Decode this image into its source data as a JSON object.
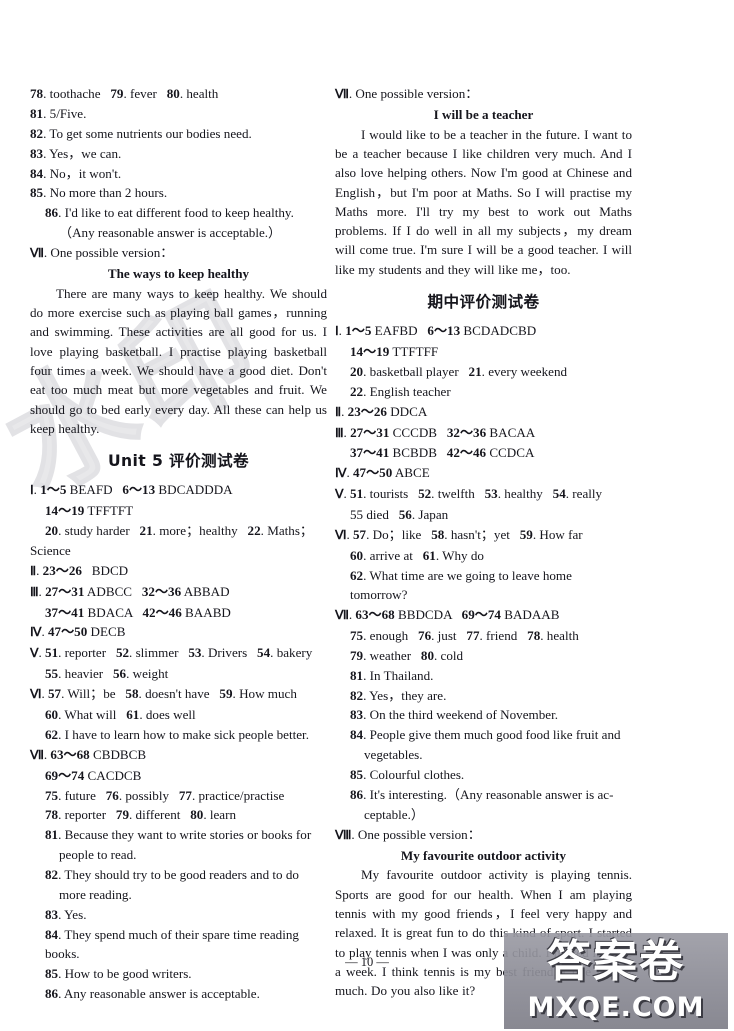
{
  "page": {
    "page_number": "— 10 —",
    "background_watermark": "水印"
  },
  "watermark_stamp": {
    "chinese": "答案卷",
    "url": "MXQE.COM"
  },
  "left_column": {
    "blocks": [
      {
        "id": "l1",
        "type": "line",
        "text": "78. toothache   79. fever   80. health"
      },
      {
        "id": "l2",
        "type": "line",
        "text": "81. 5/Five."
      },
      {
        "id": "l3",
        "type": "line",
        "text": "82. To get some nutrients our bodies need."
      },
      {
        "id": "l4",
        "type": "line",
        "text": "83. Yes，we can."
      },
      {
        "id": "l5",
        "type": "line",
        "text": "84. No，it won't."
      },
      {
        "id": "l6",
        "type": "line",
        "text": "85. No more than 2 hours."
      },
      {
        "id": "l7",
        "type": "hang",
        "text": "86. I'd like to eat different food to keep healthy."
      },
      {
        "id": "l8",
        "type": "indent2",
        "text": "（Any reasonable answer is acceptable.）"
      },
      {
        "id": "l9",
        "type": "line",
        "text": "Ⅶ. One possible version："
      },
      {
        "id": "l10",
        "type": "comp-title",
        "text": "The ways to keep healthy"
      },
      {
        "id": "l11",
        "type": "para",
        "text": "There are many ways to keep healthy. We should do more exercise such as playing ball games，running and swimming. These activities are all good for us. I love playing basketball. I practise playing basketball four times a week. We should have a good diet. Don't eat too much meat but more vegetables and fruit. We should go to bed early every day. All these can help us keep healthy."
      },
      {
        "id": "l12",
        "type": "sec-head",
        "text": "Unit 5 评价测试卷"
      },
      {
        "id": "l13",
        "type": "line",
        "text": "Ⅰ. 1～5 BEAFD   6～13 BDCADDDA"
      },
      {
        "id": "l14",
        "type": "indent",
        "text": "14～19 TFFTFT"
      },
      {
        "id": "l15",
        "type": "indent",
        "text": "20. study harder   21. more；healthy   22. Maths；"
      },
      {
        "id": "l16",
        "type": "line",
        "text": "Science"
      },
      {
        "id": "l17",
        "type": "line",
        "text": "Ⅱ. 23～26   BDCD"
      },
      {
        "id": "l18",
        "type": "line",
        "text": "Ⅲ. 27～31 ADBCC   32～36 ABBAD"
      },
      {
        "id": "l19",
        "type": "indent",
        "text": "37～41 BDACA   42～46 BAABD"
      },
      {
        "id": "l20",
        "type": "line",
        "text": "Ⅳ. 47～50 DECB"
      },
      {
        "id": "l21",
        "type": "line",
        "text": "Ⅴ. 51. reporter   52. slimmer   53. Drivers   54. bakery"
      },
      {
        "id": "l22",
        "type": "indent",
        "text": "55. heavier   56. weight"
      },
      {
        "id": "l23",
        "type": "line",
        "text": "Ⅵ. 57. Will；be   58. doesn't have   59. How much"
      },
      {
        "id": "l24",
        "type": "indent",
        "text": "60. What will   61. does well"
      },
      {
        "id": "l25",
        "type": "indent",
        "text": "62. I have to learn how to make sick people better."
      },
      {
        "id": "l26",
        "type": "line",
        "text": "Ⅶ. 63～68 CBDBCB"
      },
      {
        "id": "l27",
        "type": "indent",
        "text": "69～74 CACDCB"
      },
      {
        "id": "l28",
        "type": "indent",
        "text": "75. future   76. possibly   77. practice/practise"
      },
      {
        "id": "l29",
        "type": "indent",
        "text": "78. reporter   79. different   80. learn"
      },
      {
        "id": "l30",
        "type": "hang",
        "text": "81. Because they want to write stories or books for"
      },
      {
        "id": "l31",
        "type": "indent2",
        "text": "people to read."
      },
      {
        "id": "l32",
        "type": "hang-j",
        "text": "82. They should try to be good readers and to do"
      },
      {
        "id": "l33",
        "type": "indent2",
        "text": "more reading."
      },
      {
        "id": "l34",
        "type": "indent",
        "text": "83. Yes."
      },
      {
        "id": "l35",
        "type": "indent",
        "text": "84. They spend much of their spare time reading books."
      },
      {
        "id": "l36",
        "type": "indent",
        "text": "85. How to be good writers."
      },
      {
        "id": "l37",
        "type": "indent",
        "text": "86. Any reasonable answer is acceptable."
      }
    ]
  },
  "right_column": {
    "blocks": [
      {
        "id": "r1",
        "type": "line",
        "text": "Ⅶ. One possible version："
      },
      {
        "id": "r2",
        "type": "comp-title",
        "text": "I will be a teacher"
      },
      {
        "id": "r3",
        "type": "para",
        "text": "I would like to be a teacher in the future. I want to be a teacher because I like children very much. And I also love helping others. Now I'm good at Chinese and English，but I'm poor at Maths. So I will practise my Maths more. I'll try my best to work out Maths problems. If I do well in all my subjects，my dream will come true. I'm sure I will be a good teacher. I will like my students and they will like me，too."
      },
      {
        "id": "r4",
        "type": "sec-head",
        "text": "期中评价测试卷"
      },
      {
        "id": "r5",
        "type": "line",
        "text": "Ⅰ. 1～5 EAFBD   6～13 BCDADCBD"
      },
      {
        "id": "r6",
        "type": "indent",
        "text": "14～19 TTFTFF"
      },
      {
        "id": "r7",
        "type": "indent",
        "text": "20. basketball player   21. every weekend"
      },
      {
        "id": "r8",
        "type": "indent",
        "text": "22. English teacher"
      },
      {
        "id": "r9",
        "type": "line",
        "text": "Ⅱ. 23～26 DDCA"
      },
      {
        "id": "r10",
        "type": "line",
        "text": "Ⅲ. 27～31 CCCDB   32～36 BACAA"
      },
      {
        "id": "r11",
        "type": "indent",
        "text": "37～41 BCBDB   42～46 CCDCA"
      },
      {
        "id": "r12",
        "type": "line",
        "text": "Ⅳ. 47～50 ABCE"
      },
      {
        "id": "r13",
        "type": "line",
        "text": "Ⅴ. 51. tourists   52. twelfth   53. healthy   54. really"
      },
      {
        "id": "r14",
        "type": "indent",
        "text": "55 died   56. Japan"
      },
      {
        "id": "r15",
        "type": "line",
        "text": "Ⅵ. 57. Do；like   58. hasn't；yet   59. How far"
      },
      {
        "id": "r16",
        "type": "indent",
        "text": "60. arrive at   61. Why do"
      },
      {
        "id": "r17",
        "type": "indent",
        "text": "62. What time are we going to leave home tomorrow?"
      },
      {
        "id": "r18",
        "type": "line",
        "text": "Ⅶ. 63～68 BBDCDA   69～74 BADAAB"
      },
      {
        "id": "r19",
        "type": "indent",
        "text": "75. enough   76. just   77. friend   78. health"
      },
      {
        "id": "r20",
        "type": "indent",
        "text": "79. weather   80. cold"
      },
      {
        "id": "r21",
        "type": "indent",
        "text": "81. In Thailand."
      },
      {
        "id": "r22",
        "type": "indent",
        "text": "82. Yes，they are."
      },
      {
        "id": "r23",
        "type": "indent",
        "text": "83. On the third weekend of November."
      },
      {
        "id": "r24",
        "type": "hang-j",
        "text": "84. People give them much good food like fruit and"
      },
      {
        "id": "r25",
        "type": "indent2",
        "text": "vegetables."
      },
      {
        "id": "r26",
        "type": "indent",
        "text": "85. Colourful clothes."
      },
      {
        "id": "r27",
        "type": "hang-j",
        "text": "86. It's interesting.（Any reasonable answer is ac-"
      },
      {
        "id": "r28",
        "type": "indent2",
        "text": "ceptable.）"
      },
      {
        "id": "r29",
        "type": "line",
        "text": "Ⅷ. One possible version："
      },
      {
        "id": "r30",
        "type": "comp-title",
        "text": "My favourite outdoor activity"
      },
      {
        "id": "r31",
        "type": "para",
        "text": "My favourite outdoor activity is playing tennis. Sports are good for our health. When I am playing tennis with my good friends，I feel very happy and relaxed. It is great fun to do this kind of sport. I started to play tennis when I was only a child. I played it twice a week. I think tennis is my best friend. I like it very much. Do you also like it?"
      }
    ]
  }
}
